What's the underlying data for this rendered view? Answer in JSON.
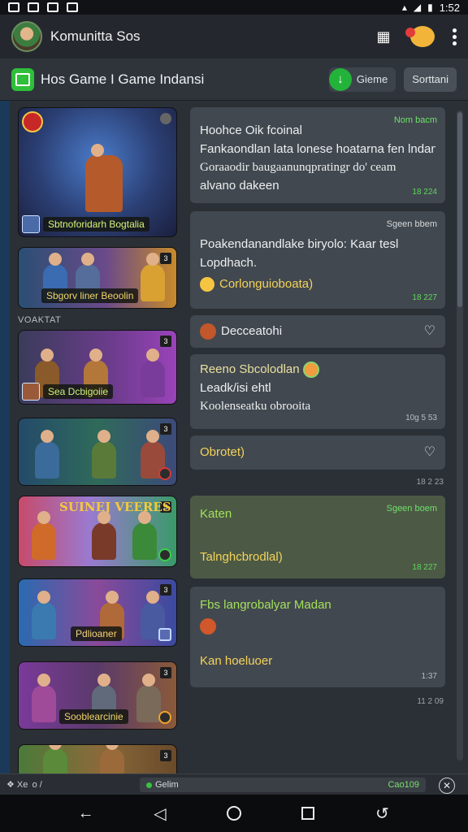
{
  "status": {
    "time": "1:52"
  },
  "app": {
    "title": "Komunitta Sos"
  },
  "sub": {
    "title": "Hos  Game I Game Indansi",
    "green_btn": "Gieme",
    "gray_btn": "Sorttani"
  },
  "section_label": "VOAKTAT",
  "thumbs": [
    {
      "caption": "Sbtnoforidarh Bogtalia",
      "badge": ""
    },
    {
      "caption": "Sbgorv liner Beoolin",
      "badge": "3"
    },
    {
      "caption": "Sea Dcbigoiie",
      "badge": "3"
    },
    {
      "caption": "",
      "badge": "3"
    },
    {
      "caption": "SUINEJ VEERES",
      "badge": "3"
    },
    {
      "caption": "Pdlioaner",
      "badge": "3"
    },
    {
      "caption": "Sooblearcinie",
      "badge": "3"
    },
    {
      "caption": "",
      "badge": "3"
    }
  ],
  "cards": {
    "c1": {
      "meta": "Nom bacm",
      "line1": "Hoohce Oik fcoinal",
      "line2": "Fankaondlan lata lonese hoatarna fen lndan",
      "line3": "Goraaodir baugaanunqpratingr do' ceam",
      "line4": "alvano dakeen",
      "ts": "18 224"
    },
    "c2": {
      "meta": "Sgeen bbem",
      "line1": "Poakendanandlake biryolo: Kaar tesl",
      "line2": "Lopdhach.",
      "line3": "Corlonguioboata)",
      "ts": "18 227"
    },
    "c3": {
      "label": "Decceatohi"
    },
    "c4": {
      "line1": "Reeno Sbcolodlan",
      "line2": "Leadk/isi ehtl",
      "line3": "Koolenseatku obrooita",
      "ts": "10g 5 53"
    },
    "c5": {
      "label": "Obrotet)",
      "outside_ts": "18 2 23"
    },
    "c6": {
      "meta": "Sgeen boem",
      "line1": "Katen",
      "line2": "Talnghcbrodlal)",
      "ts": "18 227"
    },
    "c7": {
      "line1": "Fbs langrobalyar Madan",
      "line2": "Kan hoeluoer",
      "ts": "1:37",
      "outside_ts": "11 2 09"
    }
  },
  "bottom": {
    "left": "❖  Xe  o /",
    "field": "Gelim",
    "count": "Cao109"
  },
  "icon_names": [
    "image-icon",
    "download-icon",
    "heart-icon",
    "close-icon",
    "back-icon",
    "home-icon",
    "recents-icon"
  ]
}
